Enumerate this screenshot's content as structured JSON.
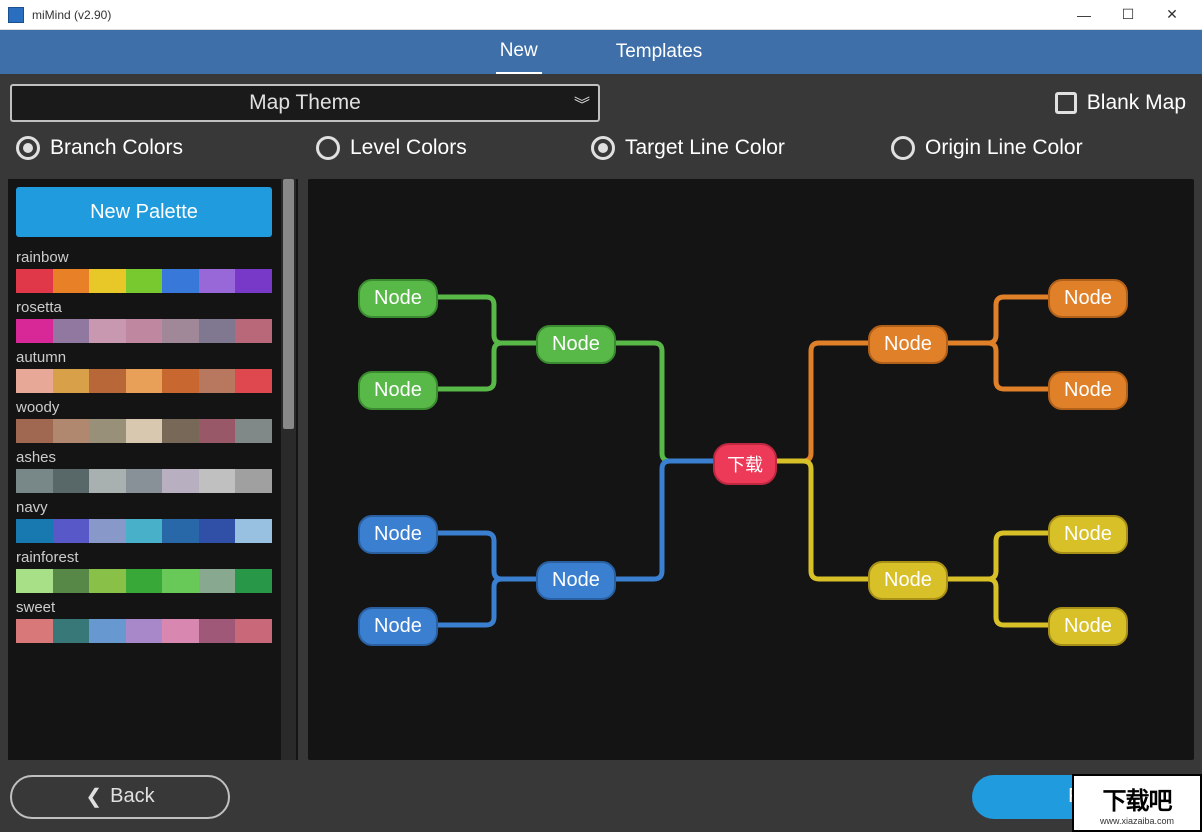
{
  "window": {
    "title": "miMind (v2.90)"
  },
  "tabs": {
    "new": "New",
    "templates": "Templates",
    "active": "new"
  },
  "theme_select": {
    "label": "Map Theme"
  },
  "blank_map": {
    "label": "Blank Map",
    "checked": false
  },
  "radios": {
    "branch": "Branch Colors",
    "level": "Level Colors",
    "target": "Target Line Color",
    "origin": "Origin Line Color"
  },
  "sidebar": {
    "new_palette": "New Palette",
    "palettes": [
      {
        "name": "rainbow",
        "colors": [
          "#e03848",
          "#e88028",
          "#e8c828",
          "#78c830",
          "#3878d8",
          "#9868d8",
          "#7838c8"
        ]
      },
      {
        "name": "rosetta",
        "colors": [
          "#d82898",
          "#9078a0",
          "#c898b0",
          "#c088a0",
          "#a08898",
          "#807890",
          "#b86878"
        ]
      },
      {
        "name": "autumn",
        "colors": [
          "#e8a898",
          "#d8a048",
          "#b86838",
          "#e8a058",
          "#c86830",
          "#b87860",
          "#e04850"
        ]
      },
      {
        "name": "woody",
        "colors": [
          "#a06850",
          "#b08870",
          "#989078",
          "#d8c8b0",
          "#786858",
          "#985868",
          "#808888"
        ]
      },
      {
        "name": "ashes",
        "colors": [
          "#788888",
          "#586868",
          "#a8b0b0",
          "#889098",
          "#b8b0c0",
          "#c0c0c0",
          "#a0a0a0"
        ]
      },
      {
        "name": "navy",
        "colors": [
          "#1878b0",
          "#5858c8",
          "#8898c8",
          "#48b0c8",
          "#2868a8",
          "#3050a8",
          "#98c0e0"
        ]
      },
      {
        "name": "rainforest",
        "colors": [
          "#a8e088",
          "#588848",
          "#88c048",
          "#38a838",
          "#68c858",
          "#88a890",
          "#289848"
        ]
      },
      {
        "name": "sweet",
        "colors": [
          "#d87878",
          "#387878",
          "#6898d0",
          "#a888c8",
          "#d888b0",
          "#a05878",
          "#c86878"
        ]
      }
    ]
  },
  "canvas": {
    "root_label": "下载",
    "node_label": "Node",
    "colors": {
      "green": {
        "fill": "#58b848",
        "border": "#3a8a2f"
      },
      "blue": {
        "fill": "#3a7fd0",
        "border": "#2a5fa0"
      },
      "orange": {
        "fill": "#e08028",
        "border": "#b06018"
      },
      "yellow": {
        "fill": "#d8c028",
        "border": "#a89018"
      },
      "root": {
        "fill": "#ed3a58",
        "border": "#c02842"
      }
    }
  },
  "buttons": {
    "back": "Back",
    "finish": "Fin"
  },
  "watermark": {
    "big": "下载吧",
    "small": "www.xiazaiba.com"
  }
}
